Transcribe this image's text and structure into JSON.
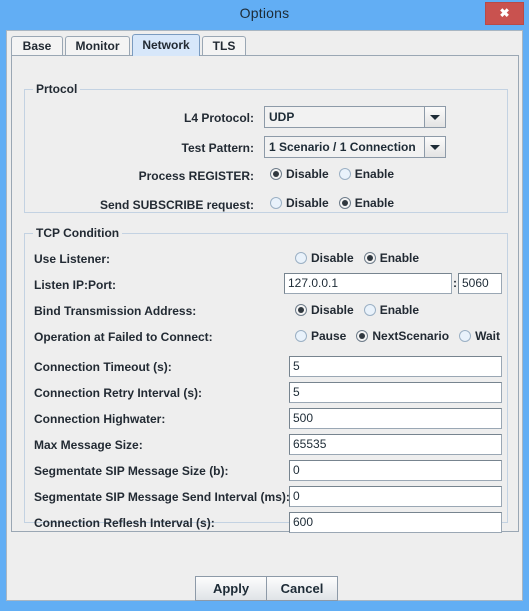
{
  "window": {
    "title": "Options",
    "close_label": "✖",
    "accent_color": "#62aef4",
    "close_color": "#c9524f"
  },
  "tabs": [
    {
      "label": "Base",
      "selected": false
    },
    {
      "label": "Monitor",
      "selected": false
    },
    {
      "label": "Network",
      "selected": true
    },
    {
      "label": "TLS",
      "selected": false
    }
  ],
  "protocol_group": {
    "title": "Prtocol",
    "l4_protocol": {
      "label": "L4 Protocol:",
      "value": "UDP"
    },
    "test_pattern": {
      "label": "Test Pattern:",
      "value": "1 Scenario / 1 Connection"
    },
    "process_register": {
      "label": "Process REGISTER:",
      "options": [
        "Disable",
        "Enable"
      ],
      "selected": "Disable"
    },
    "send_subscribe": {
      "label": "Send SUBSCRIBE request:",
      "options": [
        "Disable",
        "Enable"
      ],
      "selected": "Enable"
    }
  },
  "tcp_group": {
    "title": "TCP Condition",
    "use_listener": {
      "label": "Use Listener:",
      "options": [
        "Disable",
        "Enable"
      ],
      "selected": "Enable"
    },
    "listen_ip_port": {
      "label": "Listen IP:Port:",
      "ip": "127.0.0.1",
      "separator": ":",
      "port": "5060"
    },
    "bind_transmission_address": {
      "label": "Bind Transmission Address:",
      "options": [
        "Disable",
        "Enable"
      ],
      "selected": "Disable"
    },
    "operation_failed_connect": {
      "label": "Operation at Failed to Connect:",
      "options": [
        "Pause",
        "NextScenario",
        "Wait"
      ],
      "selected": "NextScenario"
    },
    "fields": [
      {
        "label": "Connection Timeout (s):",
        "value": "5"
      },
      {
        "label": "Connection Retry Interval (s):",
        "value": "5"
      },
      {
        "label": "Connection Highwater:",
        "value": "500"
      },
      {
        "label": "Max Message Size:",
        "value": "65535"
      },
      {
        "label": "Segmentate SIP Message Size (b):",
        "value": "0"
      },
      {
        "label": "Segmentate SIP Message Send Interval (ms):",
        "value": "0"
      },
      {
        "label": "Connection Reflesh Interval (s):",
        "value": "600"
      }
    ]
  },
  "buttons": {
    "apply": "Apply",
    "cancel": "Cancel"
  }
}
